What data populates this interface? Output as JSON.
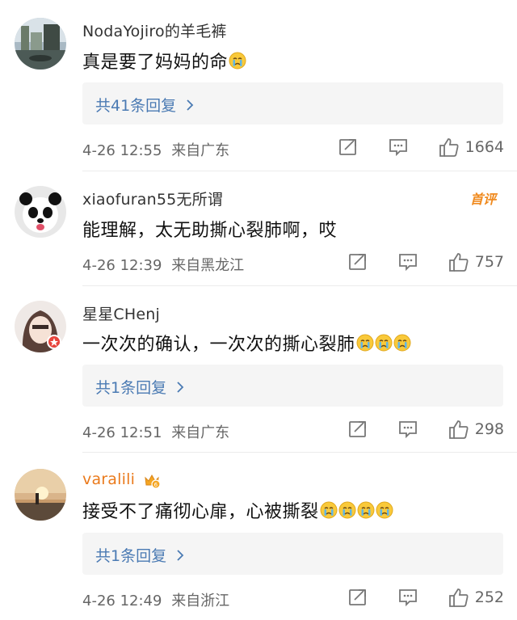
{
  "comments": [
    {
      "username": "NodaYojiro的羊毛裤",
      "text": "真是要了妈妈的命",
      "emoji_count": 1,
      "replies_label": "共41条回复",
      "time": "4-26 12:55",
      "location": "来自广东",
      "likes": "1664"
    },
    {
      "username": "xiaofuran55无所谓",
      "text": "能理解，太无助撕心裂肺啊，哎",
      "emoji_count": 0,
      "badge": "首评",
      "time": "4-26 12:39",
      "location": "来自黑龙江",
      "likes": "757"
    },
    {
      "username": "星星CHenj",
      "text": "一次次的确认，一次次的撕心裂肺",
      "emoji_count": 3,
      "replies_label": "共1条回复",
      "time": "4-26 12:51",
      "location": "来自广东",
      "likes": "298"
    },
    {
      "username": "varalili",
      "text": "接受不了痛彻心扉，心被撕裂",
      "emoji_count": 4,
      "replies_label": "共1条回复",
      "time": "4-26 12:49",
      "location": "来自浙江",
      "likes": "252"
    }
  ],
  "icons": {
    "repost": "repost-icon",
    "comment": "comment-icon",
    "like": "thumbs-up-icon",
    "emoji": "crying-face-emoji",
    "chevron": "chevron-right-icon"
  },
  "colors": {
    "link": "#4a7ab3",
    "vip_name": "#ea7a1c",
    "badge": "#f08a1e",
    "meta": "#666666"
  }
}
